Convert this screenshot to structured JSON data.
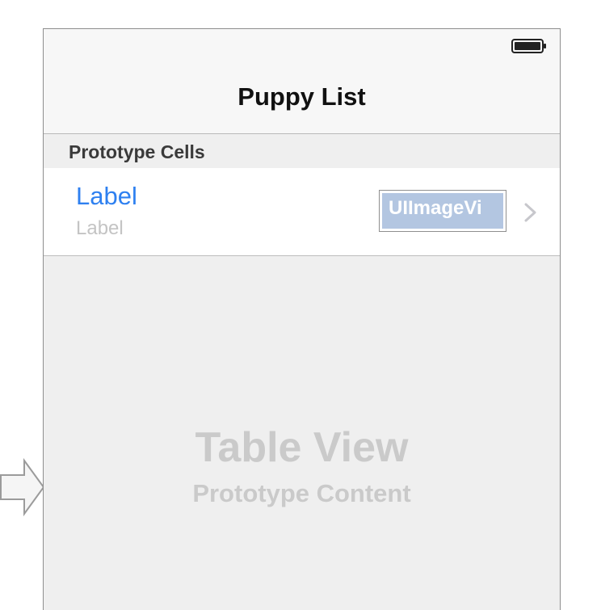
{
  "navbar": {
    "title": "Puppy List"
  },
  "status_bar": {
    "battery_icon": "battery-full-icon"
  },
  "section": {
    "title": "Prototype Cells"
  },
  "cell": {
    "title": "Label",
    "subtitle": "Label",
    "image_view_label": "UIImageVi",
    "accessory_icon": "chevron-right-icon"
  },
  "placeholder": {
    "title": "Table View",
    "subtitle": "Prototype Content"
  },
  "colors": {
    "accent": "#2e80f0",
    "image_view_fill": "#b3c6e1",
    "placeholder_text": "#cacaca",
    "background": "#efefef"
  }
}
